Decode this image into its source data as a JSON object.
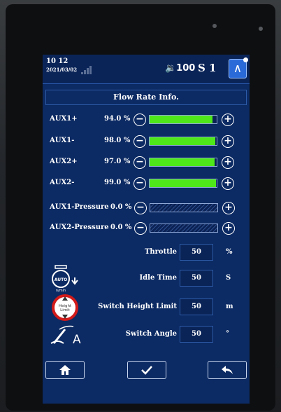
{
  "status": {
    "time": "10 12",
    "date": "2021/03/02",
    "volume": "🔉100",
    "s_value": "S 1"
  },
  "title": "Flow Rate Info.",
  "flow_rows": [
    {
      "label": "AUX1+",
      "percent": "94.0 %",
      "value": 94.0
    },
    {
      "label": "AUX1-",
      "percent": "98.0 %",
      "value": 98.0
    },
    {
      "label": "AUX2+",
      "percent": "97.0 %",
      "value": 97.0
    },
    {
      "label": "AUX2-",
      "percent": "99.0 %",
      "value": 99.0
    },
    {
      "label": "AUX1-Pressure",
      "percent": "0.0 %",
      "value": 0.0
    },
    {
      "label": "AUX2-Pressure",
      "percent": "0.0 %",
      "value": 0.0
    }
  ],
  "params": [
    {
      "label": "Throttle",
      "value": "50",
      "unit": "%"
    },
    {
      "label": "Idle Time",
      "value": "50",
      "unit": "S"
    },
    {
      "label": "Switch Height Limit",
      "value": "50",
      "unit": "m"
    },
    {
      "label": "Switch Angle",
      "value": "50",
      "unit": "°"
    }
  ],
  "icons": {
    "auto_label": "AUTO",
    "auto_sub": "n/min",
    "height_label": "Height Limit",
    "angle_letter": "A"
  },
  "colors": {
    "screen_bg": "#0c2a63",
    "bar_fill": "#4ee81a",
    "accent": "#2a6ad8"
  }
}
